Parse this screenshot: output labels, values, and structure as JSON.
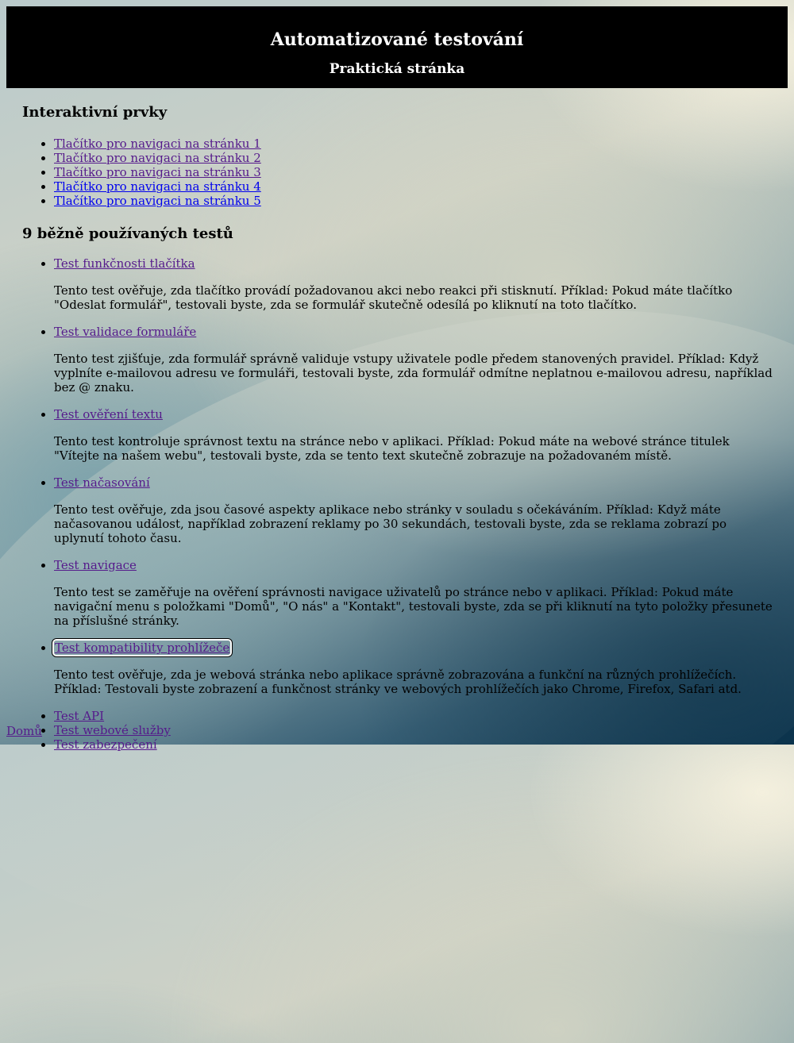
{
  "header": {
    "title": "Automatizované testování",
    "subtitle": "Praktická stránka"
  },
  "interactive": {
    "heading": "Interaktivní prvky",
    "links": [
      "Tlačítko pro navigaci na stránku 1",
      "Tlačítko pro navigaci na stránku 2",
      "Tlačítko pro navigaci na stránku 3",
      "Tlačítko pro navigaci na stránku 4",
      "Tlačítko pro navigaci na stránku 5"
    ]
  },
  "tests": {
    "heading": "9 běžně používaných testů",
    "items": [
      {
        "label": "Test funkčnosti tlačítka",
        "description": "Tento test ověřuje, zda tlačítko provádí požadovanou akci nebo reakci při stisknutí. Příklad: Pokud máte tlačítko \"Odeslat formulář\", testovali byste, zda se formulář skutečně odesílá po kliknutí na toto tlačítko."
      },
      {
        "label": "Test validace formuláře",
        "description": "Tento test zjišťuje, zda formulář správně validuje vstupy uživatele podle předem stanovených pravidel. Příklad: Když vyplníte e-mailovou adresu ve formuláři, testovali byste, zda formulář odmítne neplatnou e-mailovou adresu, například bez @ znaku."
      },
      {
        "label": "Test ověření textu",
        "description": "Tento test kontroluje správnost textu na stránce nebo v aplikaci. Příklad: Pokud máte na webové stránce titulek \"Vítejte na našem webu\", testovali byste, zda se tento text skutečně zobrazuje na požadovaném místě."
      },
      {
        "label": "Test načasování",
        "description": "Tento test ověřuje, zda jsou časové aspekty aplikace nebo stránky v souladu s očekáváním. Příklad: Když máte načasovanou událost, například zobrazení reklamy po 30 sekundách, testovali byste, zda se reklama zobrazí po uplynutí tohoto času."
      },
      {
        "label": "Test navigace",
        "description": "Tento test se zaměřuje na ověření správnosti navigace uživatelů po stránce nebo v aplikaci. Příklad: Pokud máte navigační menu s položkami \"Domů\", \"O nás\" a \"Kontakt\", testovali byste, zda se při kliknutí na tyto položky přesunete na příslušné stránky."
      },
      {
        "label": "Test kompatibility prohlížeče",
        "description": "Tento test ověřuje, zda je webová stránka nebo aplikace správně zobrazována a funkční na různých prohlížečích. Příklad: Testovali byste zobrazení a funkčnost stránky ve webových prohlížečích jako Chrome, Firefox, Safari atd."
      },
      {
        "label": "Test API"
      },
      {
        "label": "Test webové služby"
      },
      {
        "label": "Test zabezpečení"
      }
    ]
  },
  "footer": {
    "home_link": "Domů"
  }
}
